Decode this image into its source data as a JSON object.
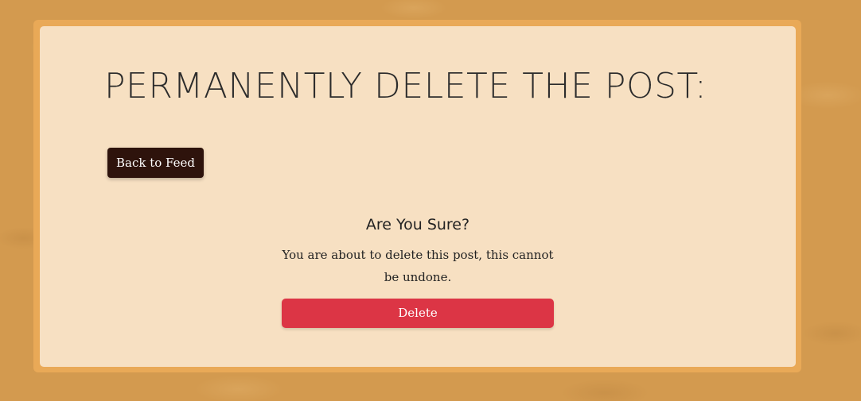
{
  "page": {
    "title": "PERMANENTLY DELETE THE POST:"
  },
  "navigation": {
    "back_label": "Back to Feed"
  },
  "confirmation": {
    "heading": "Are You Sure?",
    "message": "You are about to delete this post, this cannot be undone.",
    "delete_label": "Delete"
  },
  "colors": {
    "page_background": "#d39a4f",
    "card_background": "#f7e0c2",
    "back_button": "#2e130c",
    "delete_button": "#dc3545"
  }
}
